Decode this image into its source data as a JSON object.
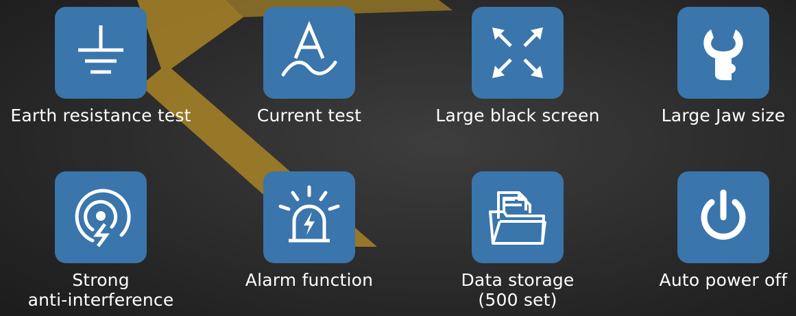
{
  "colors": {
    "tile": "#3a75ac",
    "icon": "#ffffff",
    "road_stripe": "#b8902a",
    "background": "#2c2c2c"
  },
  "features": [
    {
      "icon": "earth-ground-icon",
      "label_lines": [
        "Earth resistance test"
      ]
    },
    {
      "icon": "current-ampere-icon",
      "label_lines": [
        "Current test"
      ]
    },
    {
      "icon": "expand-arrows-icon",
      "label_lines": [
        "Large black screen"
      ]
    },
    {
      "icon": "clamp-jaw-icon",
      "label_lines": [
        "Large Jaw size"
      ]
    },
    {
      "icon": "anti-interference-icon",
      "label_lines": [
        "Strong",
        "anti-interference"
      ]
    },
    {
      "icon": "alarm-beacon-icon",
      "label_lines": [
        "Alarm function"
      ]
    },
    {
      "icon": "folder-documents-icon",
      "label_lines": [
        "Data storage",
        "(500 set)"
      ]
    },
    {
      "icon": "power-icon",
      "label_lines": [
        "Auto power off"
      ]
    }
  ]
}
